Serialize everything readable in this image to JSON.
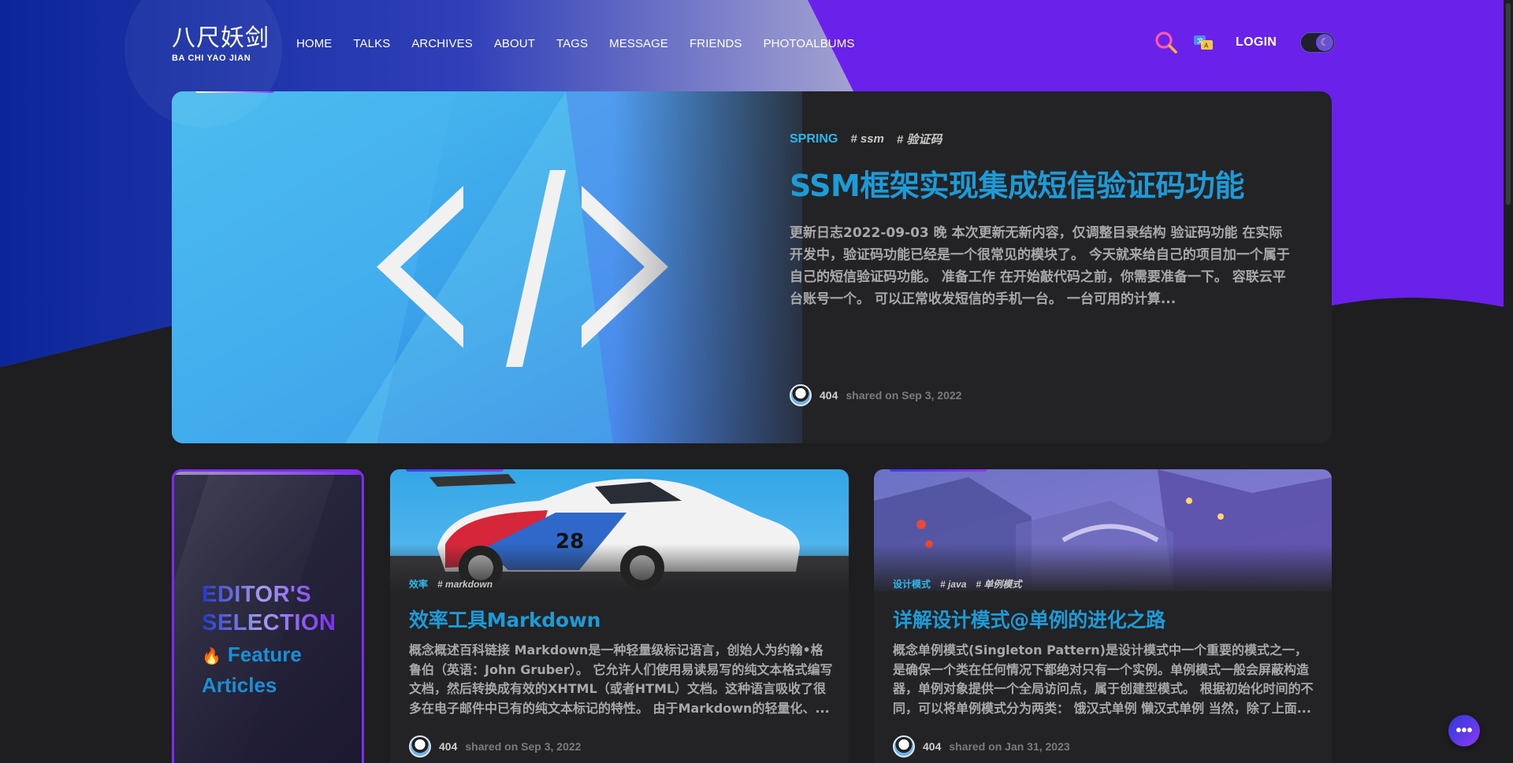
{
  "header": {
    "logo_cn": "八尺妖剑",
    "logo_en": "BA CHI YAO JIAN",
    "nav": [
      "HOME",
      "TALKS",
      "ARCHIVES",
      "ABOUT",
      "TAGS",
      "MESSAGE",
      "FRIENDS",
      "PHOTOALBUMS"
    ],
    "login": "LOGIN",
    "icons": [
      "search-icon",
      "translate-icon",
      "moon-icon"
    ]
  },
  "featured": {
    "category": "SPRING",
    "tags": [
      "# ssm",
      "# 验证码"
    ],
    "title": "SSM框架实现集成短信验证码功能",
    "excerpt": "更新日志2022-09-03 晚 本次更新无新内容，仅调整目录结构 验证码功能 在实际开发中，验证码功能已经是一个很常见的模块了。 今天就来给自己的项目加一个属于自己的短信验证码功能。 准备工作 在开始敲代码之前，你需要准备一下。 容联云平台账号一个。 可以正常收发短信的手机一台。 一台可用的计算...",
    "author": "404",
    "shared": "shared on Sep 3, 2022"
  },
  "editor": {
    "title_line1": "EDITOR'S",
    "title_line2": "SELECTION",
    "feature_line1": "Feature",
    "feature_line2": "Articles"
  },
  "cards": [
    {
      "category": "效率",
      "tags": [
        "# markdown"
      ],
      "title": "效率工具Markdown",
      "excerpt": "概念概述百科链接 Markdown是一种轻量级标记语言，创始人为约翰•格鲁伯（英语：John Gruber）。 它允许人们使用易读易写的纯文本格式编写文档，然后转换成有效的XHTML（或者HTML）文档。这种语言吸收了很多在电子邮件中已有的纯文本标记的特性。 由于Markdown的轻量化、...",
      "author": "404",
      "shared": "shared on Sep 3, 2022"
    },
    {
      "category": "设计模式",
      "tags": [
        "# java",
        "# 单例模式"
      ],
      "title": "详解设计模式@单例的进化之路",
      "excerpt": "概念单例模式(Singleton Pattern)是设计模式中一个重要的模式之一，是确保一个类在任何情况下都绝对只有一个实例。单例模式一般会屏蔽构造器，单例对象提供一个全局访问点，属于创建型模式。 根据初始化时间的不同，可以将单例模式分为两类： 饿汉式单例 懒汉式单例 当然，除了上面...",
      "author": "404",
      "shared": "shared on Jan 31, 2023"
    }
  ],
  "fab": "•••",
  "colors": {
    "accent": "#1e9ad6",
    "category": "#2fb7ea",
    "purple": "#7d2df0",
    "page_bg": "#1e1e21"
  }
}
